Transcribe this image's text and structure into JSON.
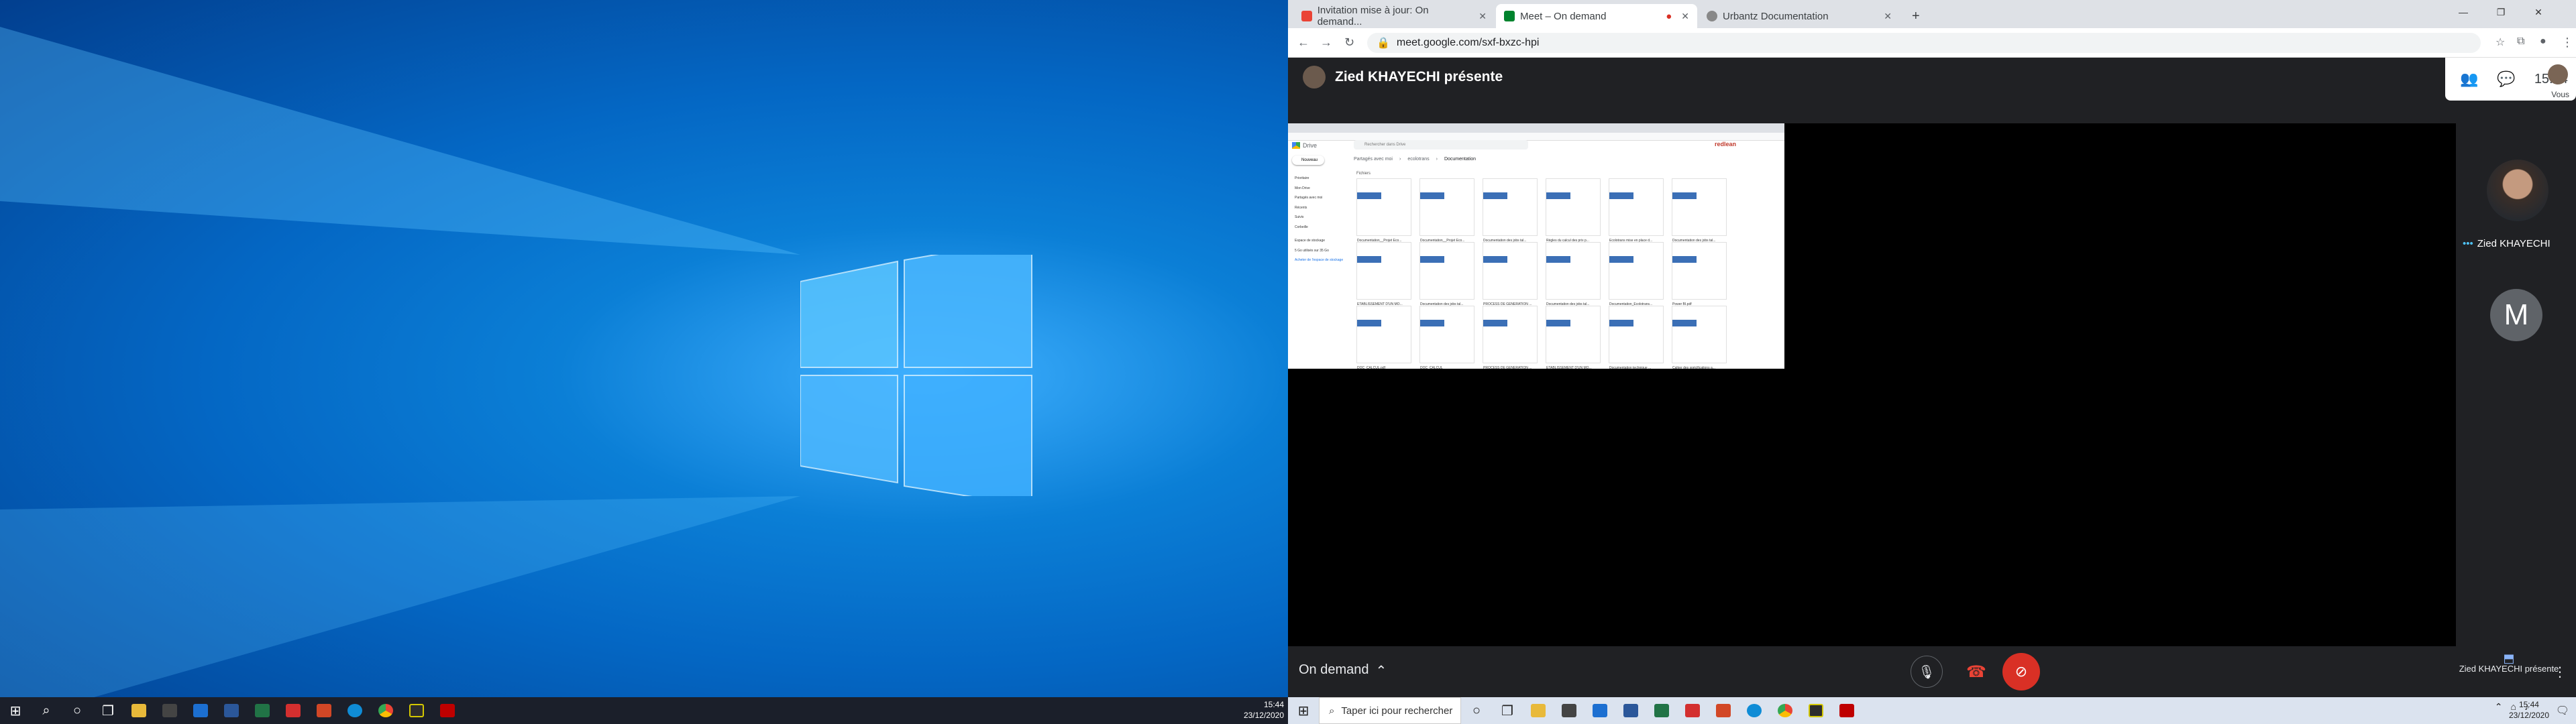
{
  "desktop1": {
    "clock_time": "15:44",
    "clock_date": "23/12/2020"
  },
  "browser": {
    "tabs": [
      {
        "label": "Invitation mise à jour: On demand..."
      },
      {
        "label": "Meet – On demand"
      },
      {
        "label": "Urbantz Documentation"
      }
    ],
    "url": "meet.google.com/sxf-bxzc-hpi"
  },
  "meet": {
    "presenter": "Zied KHAYECHI présente",
    "time": "15:44",
    "you_label": "Vous",
    "participant_name": "Zied KHAYECHI",
    "participant_initial": "M",
    "meeting_title": "On demand",
    "presenting_label": "Zied KHAYECHI présente",
    "drive": {
      "title": "Drive",
      "search_placeholder": "Rechercher dans Drive",
      "new_button": "Nouveau",
      "breadcrumb": [
        "Partagés avec moi",
        "ecolotrans",
        "Documentation"
      ],
      "section": "Fichiers",
      "storage": "Espace de stockage",
      "storage_used": "5 Go utilisés sur 35 Go",
      "buy_storage": "Acheter de l'espace de stockage",
      "nav": [
        "Prioritaire",
        "Mon Drive",
        "Partagés avec moi",
        "Récents",
        "Suivis",
        "Corbeille"
      ],
      "files": [
        "Documentation__Projet Eco...",
        "Documentation__Projet Eco...",
        "Documentation des jobs tal...",
        "Règles du calcul des prix p...",
        "Ecolotrans mise en place d...",
        "Documentation des jobs tal...",
        "ETABLISSEMENT D'UN MO...",
        "Documentation des jobs tal...",
        "PROCESS DE GENERATION ...",
        "Documentation des jobs tal...",
        "Documentation_Ecolotrans...",
        "Power BI.pdf",
        "DOC_CALCUL.pdf",
        "DOC_CALCUL",
        "PROCESS DE GENERATION ...",
        "ETABLISSEMENT D'UN MO...",
        "Documentation technique ...",
        "Cahier des spécifications a..."
      ],
      "thumb_text": [
        "Documentation Projet Ecolotrans",
        "Documentation Projet Ecolotrans",
        "Documentation Projet Ecolotrans",
        "",
        "Mise en place du Databab",
        "Documentation Projet Ecolotrans"
      ],
      "brand": "redlean"
    }
  },
  "taskbar2": {
    "search_placeholder": "Taper ici pour rechercher",
    "clock_time": "15:44",
    "clock_date": "23/12/2020"
  }
}
